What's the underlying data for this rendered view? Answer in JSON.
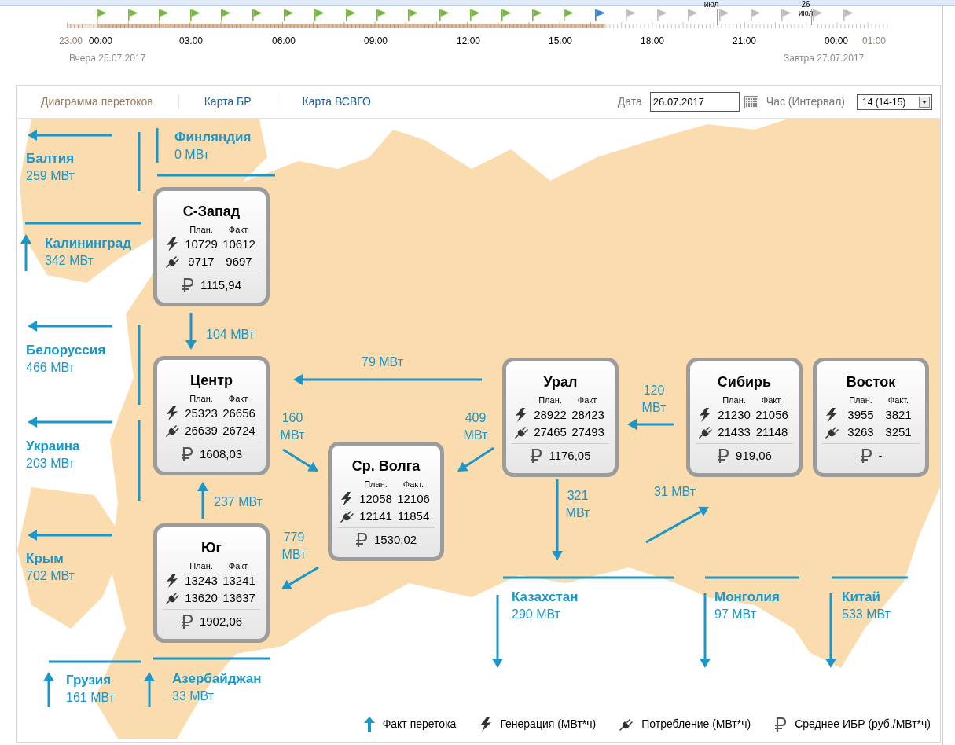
{
  "timeline": {
    "flags": [
      {
        "done": true,
        "current": false
      },
      {
        "done": true,
        "current": false
      },
      {
        "done": true,
        "current": false
      },
      {
        "done": true,
        "current": false
      },
      {
        "done": true,
        "current": false
      },
      {
        "done": true,
        "current": false
      },
      {
        "done": true,
        "current": false
      },
      {
        "done": true,
        "current": false
      },
      {
        "done": true,
        "current": false
      },
      {
        "done": true,
        "current": false
      },
      {
        "done": true,
        "current": false
      },
      {
        "done": true,
        "current": false
      },
      {
        "done": true,
        "current": false
      },
      {
        "done": true,
        "current": false
      },
      {
        "done": true,
        "current": false
      },
      {
        "done": true,
        "current": false
      },
      {
        "done": true,
        "current": true
      },
      {
        "done": false,
        "current": false
      },
      {
        "done": false,
        "current": false
      },
      {
        "done": false,
        "current": false
      },
      {
        "done": false,
        "current": false
      },
      {
        "done": false,
        "current": false
      },
      {
        "done": false,
        "current": false
      },
      {
        "done": false,
        "current": false
      },
      {
        "done": false,
        "current": false
      }
    ],
    "hours": [
      {
        "label": "23:00",
        "kind": "edge"
      },
      {
        "label": "00:00",
        "kind": "main"
      },
      {
        "label": "03:00",
        "kind": "main"
      },
      {
        "label": "06:00",
        "kind": "main"
      },
      {
        "label": "09:00",
        "kind": "main"
      },
      {
        "label": "12:00",
        "kind": "main"
      },
      {
        "label": "15:00",
        "kind": "main"
      },
      {
        "label": "18:00",
        "kind": "main"
      },
      {
        "label": "21:00",
        "kind": "main"
      },
      {
        "label": "00:00",
        "kind": "main"
      },
      {
        "label": "01:00",
        "kind": "edge"
      }
    ],
    "month_markers": [
      "июл",
      "26 июл"
    ],
    "yesterday": "Вчера 25.07.2017",
    "tomorrow": "Завтра 27.07.2017"
  },
  "tabs": [
    {
      "label": "Диаграмма перетоков",
      "selected": true
    },
    {
      "label": "Карта БР",
      "selected": false
    },
    {
      "label": "Карта ВСВГО",
      "selected": false
    }
  ],
  "date": {
    "label": "Дата",
    "value": "26.07.2017"
  },
  "hour": {
    "label": "Час (Интервал)",
    "value": "14 (14-15)"
  },
  "regions": [
    {
      "name": "С-Запад",
      "plan_header": "План.",
      "fact_header": "Факт.",
      "generation_plan": "10729",
      "generation_fact": "10612",
      "consumption_plan": "9717",
      "consumption_fact": "9697",
      "price": "1115,94"
    },
    {
      "name": "Центр",
      "plan_header": "План.",
      "fact_header": "Факт.",
      "generation_plan": "25323",
      "generation_fact": "26656",
      "consumption_plan": "26639",
      "consumption_fact": "26724",
      "price": "1608,03"
    },
    {
      "name": "Ср. Волга",
      "plan_header": "План.",
      "fact_header": "Факт.",
      "generation_plan": "12058",
      "generation_fact": "12106",
      "consumption_plan": "12141",
      "consumption_fact": "11854",
      "price": "1530,02"
    },
    {
      "name": "Юг",
      "plan_header": "План.",
      "fact_header": "Факт.",
      "generation_plan": "13243",
      "generation_fact": "13241",
      "consumption_plan": "13620",
      "consumption_fact": "13637",
      "price": "1902,06"
    },
    {
      "name": "Урал",
      "plan_header": "План.",
      "fact_header": "Факт.",
      "generation_plan": "28922",
      "generation_fact": "28423",
      "consumption_plan": "27465",
      "consumption_fact": "27493",
      "price": "1176,05"
    },
    {
      "name": "Сибирь",
      "plan_header": "План.",
      "fact_header": "Факт.",
      "generation_plan": "21230",
      "generation_fact": "21056",
      "consumption_plan": "21433",
      "consumption_fact": "21148",
      "price": "919,06"
    },
    {
      "name": "Восток",
      "plan_header": "План.",
      "fact_header": "Факт.",
      "generation_plan": "3955",
      "generation_fact": "3821",
      "consumption_plan": "3263",
      "consumption_fact": "3251",
      "price": "-"
    }
  ],
  "exchanges": [
    {
      "name": "Балтия",
      "value": "259 МВт"
    },
    {
      "name": "Финляндия",
      "value": "0 МВт"
    },
    {
      "name": "Калининград",
      "value": "342 МВт"
    },
    {
      "name": "Белоруссия",
      "value": "466 МВт"
    },
    {
      "name": "Украина",
      "value": "203 МВт"
    },
    {
      "name": "Крым",
      "value": "702 МВт"
    },
    {
      "name": "Грузия",
      "value": "161 МВт"
    },
    {
      "name": "Азербайджан",
      "value": "33 МВт"
    },
    {
      "name": "Казахстан",
      "value": "290 МВт"
    },
    {
      "name": "Монголия",
      "value": "97 МВт"
    },
    {
      "name": "Китай",
      "value": "533 МВт"
    }
  ],
  "flows": [
    "104 МВт",
    "79 МВт",
    "160 МВт",
    "409 МВт",
    "120 МВт",
    "237 МВт",
    "779 МВт",
    "321 МВт",
    "31 МВт"
  ],
  "legend": [
    {
      "kind": "flow",
      "label": "Факт перетока"
    },
    {
      "kind": "generation",
      "label": "Генерация (МВт*ч)"
    },
    {
      "kind": "consumption",
      "label": "Потребление (МВт*ч)"
    },
    {
      "kind": "price",
      "label": "Среднее ИБР (руб./МВт*ч)"
    }
  ]
}
